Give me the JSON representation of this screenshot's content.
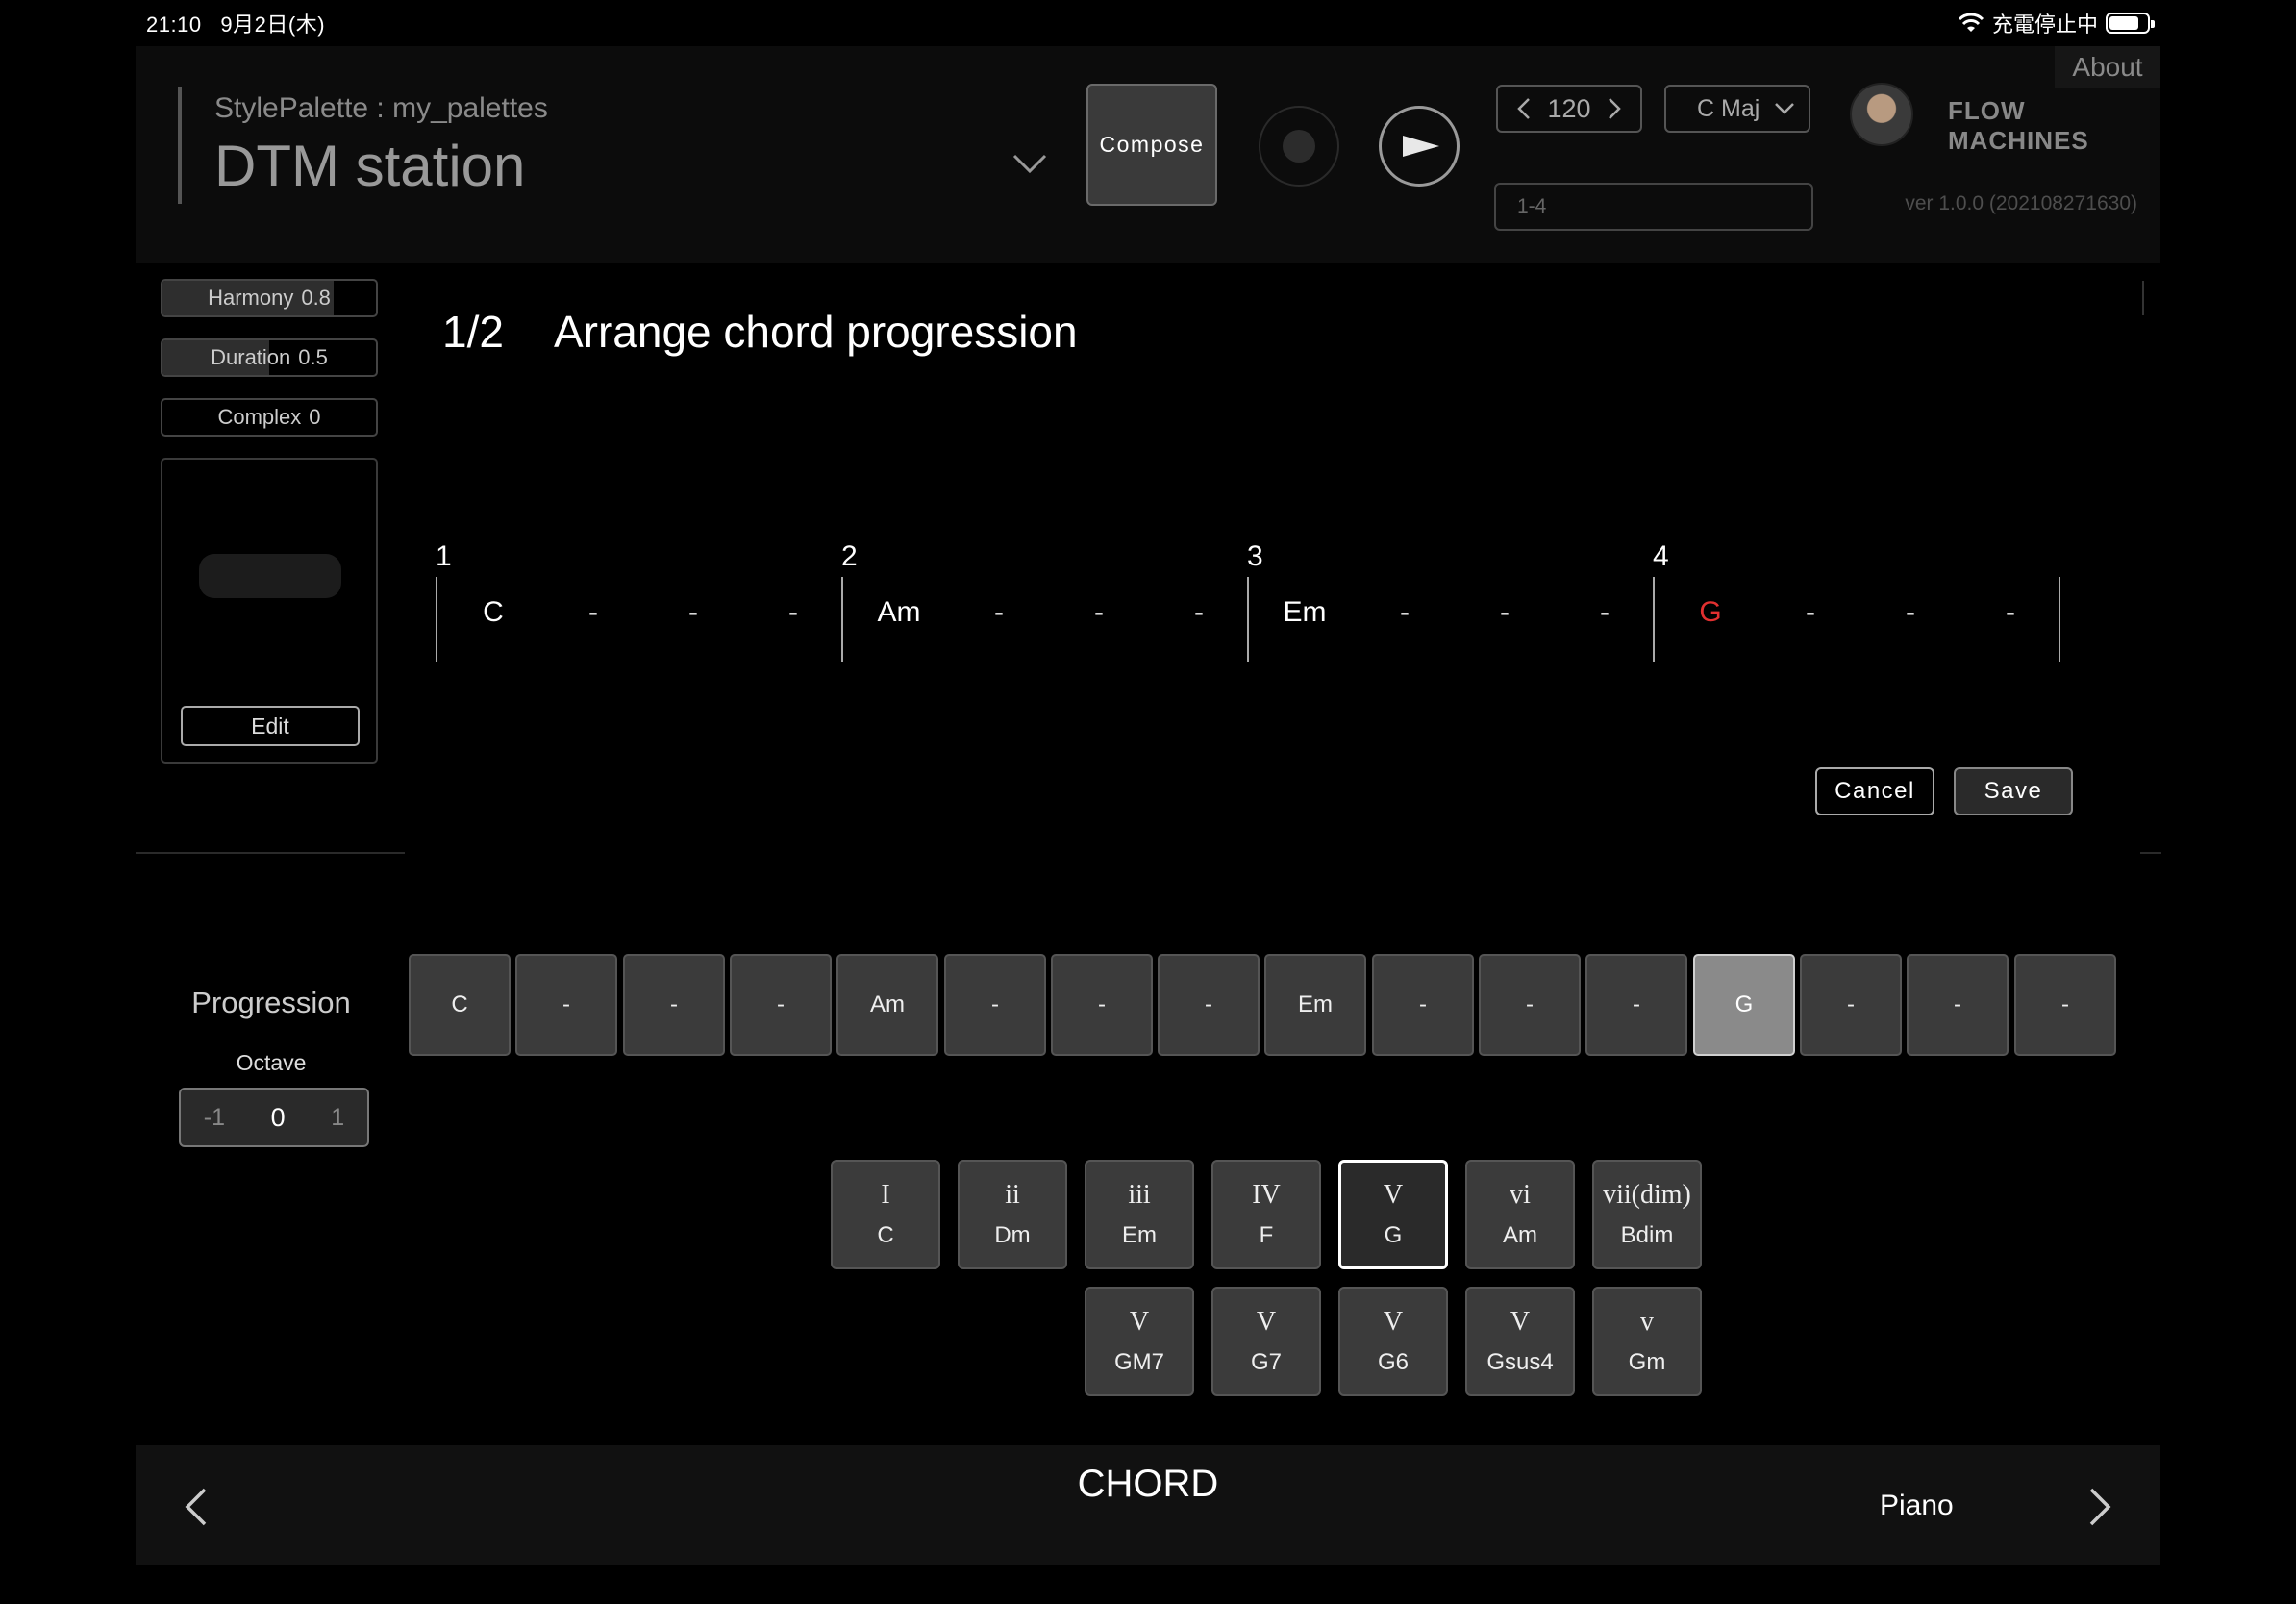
{
  "status_bar": {
    "time": "21:10",
    "date": "9月2日(木)",
    "charging": "充電停止中"
  },
  "header": {
    "palette_label": "StylePalette : my_palettes",
    "project_title": "DTM station",
    "compose_label": "Compose",
    "tempo": "120",
    "key": "C Maj",
    "range_value": "1-4",
    "brand": "FLOW MACHINES",
    "about_label": "About",
    "version": "ver 1.0.0 (202108271630)"
  },
  "params": [
    {
      "name": "Harmony",
      "value": "0.8",
      "level": 0.8
    },
    {
      "name": "Duration",
      "value": "0.5",
      "level": 0.5
    },
    {
      "name": "Complex",
      "value": "0",
      "level": 0
    }
  ],
  "palette": {
    "edit_label": "Edit"
  },
  "editor": {
    "step": "1/2",
    "title": "Arrange chord progression",
    "bars": [
      "1",
      "2",
      "3",
      "4"
    ],
    "slots": [
      "C",
      "-",
      "-",
      "-",
      "Am",
      "-",
      "-",
      "-",
      "Em",
      "-",
      "-",
      "-",
      "G",
      "-",
      "-",
      "-"
    ],
    "highlight_color": "#e23030",
    "cancel_label": "Cancel",
    "save_label": "Save"
  },
  "progression": {
    "label": "Progression",
    "octave_label": "Octave",
    "octave_options": [
      "-1",
      "0",
      "1"
    ],
    "octave_selected": "0",
    "cells": [
      "C",
      "-",
      "-",
      "-",
      "Am",
      "-",
      "-",
      "-",
      "Em",
      "-",
      "-",
      "-",
      "G",
      "-",
      "-",
      "-"
    ],
    "selected_index": 12
  },
  "degrees_row1": [
    {
      "roman": "I",
      "chord": "C"
    },
    {
      "roman": "ii",
      "chord": "Dm"
    },
    {
      "roman": "iii",
      "chord": "Em"
    },
    {
      "roman": "IV",
      "chord": "F"
    },
    {
      "roman": "V",
      "chord": "G",
      "selected": true
    },
    {
      "roman": "vi",
      "chord": "Am"
    },
    {
      "roman": "vii(dim)",
      "chord": "Bdim"
    }
  ],
  "degrees_row2": [
    {
      "roman": "V",
      "chord": "GM7"
    },
    {
      "roman": "V",
      "chord": "G7"
    },
    {
      "roman": "V",
      "chord": "G6"
    },
    {
      "roman": "V",
      "chord": "Gsus4"
    },
    {
      "roman": "v",
      "chord": "Gm"
    }
  ],
  "footer": {
    "title": "CHORD",
    "instrument": "Piano"
  }
}
